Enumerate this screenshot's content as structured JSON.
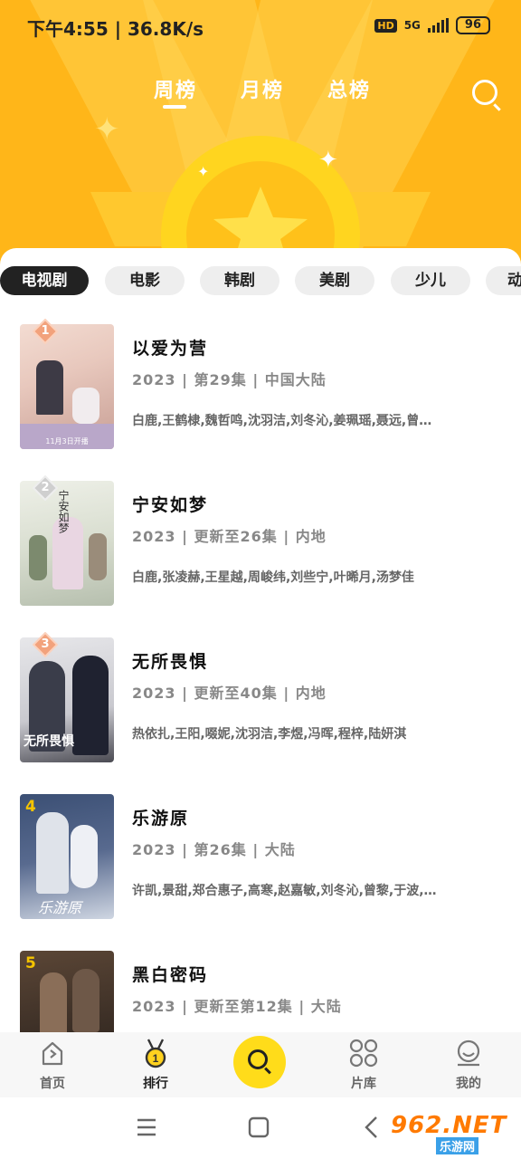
{
  "status_bar": {
    "time_speed": "下午4:55 | 36.8K/s",
    "hd": "HD",
    "net": "5G",
    "battery": "96"
  },
  "top_tabs": [
    {
      "label": "周榜",
      "active": true
    },
    {
      "label": "月榜",
      "active": false
    },
    {
      "label": "总榜",
      "active": false
    }
  ],
  "categories": [
    {
      "label": "电视剧",
      "active": true
    },
    {
      "label": "电影",
      "active": false
    },
    {
      "label": "韩剧",
      "active": false
    },
    {
      "label": "美剧",
      "active": false
    },
    {
      "label": "少儿",
      "active": false
    },
    {
      "label": "动",
      "active": false
    }
  ],
  "items": [
    {
      "rank": "1",
      "title": "以爱为营",
      "meta": "2023 | 第29集 | 中国大陆",
      "cast": "白鹿,王鹤棣,魏哲鸣,沈羽洁,刘冬沁,姜珮瑶,聂远,曾…",
      "poster_caption": "11月3日开播"
    },
    {
      "rank": "2",
      "title": "宁安如梦",
      "meta": "2023 | 更新至26集 | 内地",
      "cast": "白鹿,张凌赫,王星越,周峻纬,刘些宁,叶晞月,汤梦佳",
      "poster_caption": "宁安如梦"
    },
    {
      "rank": "3",
      "title": "无所畏惧",
      "meta": "2023 | 更新至40集 | 内地",
      "cast": "热依扎,王阳,啜妮,沈羽洁,李煜,冯晖,程梓,陆妍淇",
      "poster_caption": "无所畏惧"
    },
    {
      "rank": "4",
      "title": "乐游原",
      "meta": "2023 | 第26集 | 大陆",
      "cast": "许凯,景甜,郑合惠子,高寒,赵嘉敏,刘冬沁,曾黎,于波,…",
      "poster_caption": "乐游原"
    },
    {
      "rank": "5",
      "title": "黑白密码",
      "meta": "2023 | 更新至第12集 | 大陆",
      "cast": "",
      "poster_caption": ""
    }
  ],
  "bottom_nav": {
    "home": "首页",
    "rank": "排行",
    "library": "片库",
    "mine": "我的"
  },
  "watermark": {
    "main": "962.NET",
    "sub": "乐游网"
  },
  "colors": {
    "header_bg": "#ffb619",
    "coin": "#ffd51f",
    "center_button": "#ffdc1a",
    "rank_badge_top3": "#f2a27c",
    "rank_badge_other": "#f5c400"
  }
}
